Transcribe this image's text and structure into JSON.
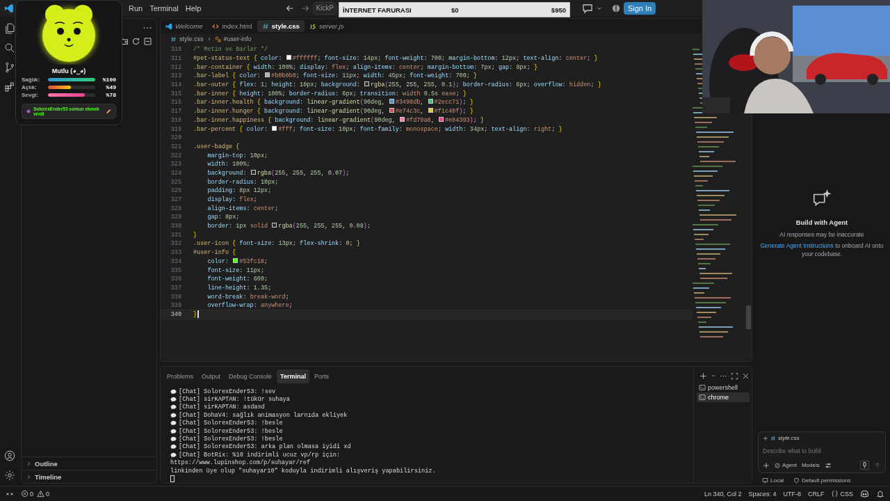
{
  "title_bar": {
    "menu": [
      "Run",
      "Terminal",
      "Help"
    ],
    "search": "KickP",
    "sign_in": "Sign In"
  },
  "donation_bar": {
    "title": "İNTERNET FARURASI",
    "current": "$0",
    "goal": "$950",
    "level": 0
  },
  "pet": {
    "mood": "Mutlu (◕‿◕)",
    "badge": "SolorexEnder53 somun ekmek verdi",
    "stats": [
      {
        "kind": "health",
        "label": "Sağlık:",
        "level": 1,
        "reading": "%100"
      },
      {
        "kind": "hunger",
        "label": "Açlık:",
        "level": 0.49,
        "reading": "%49"
      },
      {
        "kind": "happiness",
        "label": "Sevgi:",
        "level": 0.78,
        "reading": "%78"
      }
    ]
  },
  "sidebar": {
    "sections": [
      {
        "label": "Outline",
        "expanded": false
      },
      {
        "label": "Timeline",
        "expanded": false
      }
    ]
  },
  "editor": {
    "tabs": [
      {
        "label": "Welcome",
        "kind": "vscode",
        "preview": true,
        "selected": false
      },
      {
        "label": "index.html",
        "kind": "html",
        "preview": false,
        "selected": false
      },
      {
        "label": "style.css",
        "kind": "css",
        "preview": false,
        "selected": true
      },
      {
        "label": "server.js",
        "kind": "js",
        "preview": true,
        "selected": false
      }
    ],
    "breadcrumb": [
      "style.css",
      "#user-info"
    ],
    "lines": [
      {
        "n": "310",
        "text": "/* Metin ve Barlar */",
        "current": false
      },
      {
        "n": "311",
        "text": "#pet-status-text { color: #ffffff; font-size: 14px; font-weight: 700; margin-bottom: 12px; text-align: center; }",
        "current": false
      },
      {
        "n": "312",
        "text": ".bar-container { width: 100%; display: flex; align-items: center; margin-bottom: 7px; gap: 8px; }",
        "current": false
      },
      {
        "n": "313",
        "text": ".bar-label { color: #b0b0b0; font-size: 11px; width: 45px; font-weight: 700; }",
        "current": false
      },
      {
        "n": "314",
        "text": ".bar-outer { flex: 1; height: 10px; background: rgba(255, 255, 255, 0.1); border-radius: 6px; overflow: hidden; }",
        "current": false
      },
      {
        "n": "315",
        "text": ".bar-inner { height: 100%; border-radius: 6px; transition: width 0.5s ease; }",
        "current": false
      },
      {
        "n": "316",
        "text": ".bar-inner.health { background: linear-gradient(90deg, #3498db, #2ecc71); }",
        "current": false
      },
      {
        "n": "317",
        "text": ".bar-inner.hunger { background: linear-gradient(90deg, #e74c3c, #f1c40f); }",
        "current": false
      },
      {
        "n": "318",
        "text": ".bar-inner.happiness { background: linear-gradient(90deg, #fd79a8, #e84393); }",
        "current": false
      },
      {
        "n": "319",
        "text": ".bar-percent { color: #fff; font-size: 10px; font-family: monospace; width: 34px; text-align: right; }",
        "current": false
      },
      {
        "n": "320",
        "current": false
      },
      {
        "n": "321",
        "text": ".user-badge {",
        "current": false
      },
      {
        "n": "322",
        "text": "    margin-top: 10px;",
        "current": false
      },
      {
        "n": "323",
        "text": "    width: 100%;",
        "current": false
      },
      {
        "n": "324",
        "text": "    background: rgba(255, 255, 255, 0.07);",
        "current": false
      },
      {
        "n": "325",
        "text": "    border-radius: 10px;",
        "current": false
      },
      {
        "n": "326",
        "text": "    padding: 8px 12px;",
        "current": false
      },
      {
        "n": "327",
        "text": "    display: flex;",
        "current": false
      },
      {
        "n": "328",
        "text": "    align-items: center;",
        "current": false
      },
      {
        "n": "329",
        "text": "    gap: 8px;",
        "current": false
      },
      {
        "n": "330",
        "text": "    border: 1px solid rgba(255, 255, 255, 0.08);",
        "current": false
      },
      {
        "n": "331",
        "text": "}",
        "current": false
      },
      {
        "n": "332",
        "text": ".user-icon { font-size: 13px; flex-shrink: 0; }",
        "current": false
      },
      {
        "n": "333",
        "text": "#user-info {",
        "current": false
      },
      {
        "n": "334",
        "text": "    color: #53fc18;",
        "current": false
      },
      {
        "n": "335",
        "text": "    font-size: 11px;",
        "current": false
      },
      {
        "n": "336",
        "text": "    font-weight: 600;",
        "current": false
      },
      {
        "n": "337",
        "text": "    line-height: 1.35;",
        "current": false
      },
      {
        "n": "338",
        "text": "    word-break: break-word;",
        "current": false
      },
      {
        "n": "339",
        "text": "    overflow-wrap: anywhere;",
        "current": false
      },
      {
        "n": "340",
        "text": "}",
        "current": true
      }
    ]
  },
  "panel": {
    "tabs": [
      {
        "label": "Problems",
        "selected": false
      },
      {
        "label": "Output",
        "selected": false
      },
      {
        "label": "Debug Console",
        "selected": false
      },
      {
        "label": "Terminal",
        "selected": true
      },
      {
        "label": "Ports",
        "selected": false
      }
    ],
    "lines": [
      {
        "kind": "chat",
        "text": "[Chat] SolorexEnder53: !sev"
      },
      {
        "kind": "chat",
        "text": "[Chat] sirKAPTAN: !tükür suhaya"
      },
      {
        "kind": "chat",
        "text": "[Chat] sirKAPTAN: asdasd"
      },
      {
        "kind": "chat",
        "text": "[Chat] DohaV4: sağlık animasyon larnıda ekliyek"
      },
      {
        "kind": "chat",
        "text": "[Chat] SolorexEnder53: !besle"
      },
      {
        "kind": "chat",
        "text": "[Chat] SolorexEnder53: !besle"
      },
      {
        "kind": "chat",
        "text": "[Chat] SolorexEnder53: !besle"
      },
      {
        "kind": "chat",
        "text": "[Chat] SolorexEnder53: arka plan olmasa iyidi xd"
      },
      {
        "kind": "chat",
        "text": "[Chat] BotRix: %10 indirimli ucuz vp/rp için:"
      },
      {
        "kind": "plain",
        "text": "https://www.lupinshop.com/p/suhayar/ref"
      },
      {
        "kind": "plain",
        "text": "linkinden üye olup \"suhayar10\" koduyla indirimli alışveriş yapabilirsiniz."
      }
    ],
    "terminals": [
      {
        "label": "powershell",
        "selected": false
      },
      {
        "label": "chrome",
        "selected": true
      }
    ]
  },
  "chat": {
    "title": "Build with Agent",
    "note": "AI responses may be inaccurate",
    "link": "Generate Agent Instructions",
    "after_link": "to onboard AI onto your codebase.",
    "context_file": "style.css",
    "placeholder": "Describe what to build",
    "mode": "Agent",
    "models": "Models",
    "location": "Local",
    "permissions": "Default permissions"
  },
  "status_bar": {
    "errors": "0",
    "warnings": "0",
    "position": "Ln 340, Col 2",
    "indent": "Spaces: 4",
    "encoding": "UTF-8",
    "eol": "CRLF",
    "language": "CSS"
  }
}
